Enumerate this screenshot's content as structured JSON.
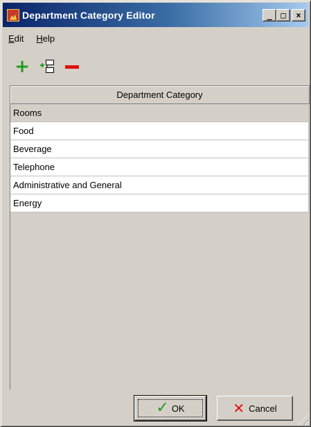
{
  "window": {
    "title": "Department Category Editor",
    "minimize_glyph": "_",
    "maximize_glyph": "□",
    "close_glyph": "×"
  },
  "menu": {
    "edit": {
      "accel": "E",
      "rest": "dit"
    },
    "help": {
      "accel": "H",
      "rest": "elp"
    }
  },
  "toolbar": {
    "add_icon": "plus-icon",
    "add_child_icon": "add-child-icon",
    "remove_icon": "minus-icon"
  },
  "table": {
    "column_header": "Department Category",
    "rows": [
      "Rooms",
      "Food",
      "Beverage",
      "Telephone",
      "Administrative and General",
      "Energy"
    ],
    "selected_index": 0
  },
  "buttons": {
    "ok_label": "OK",
    "cancel_label": "Cancel"
  },
  "colors": {
    "title_start": "#0a246a",
    "title_end": "#a6caf0",
    "add_green": "#1f9a1f",
    "remove_red": "#e01010",
    "face": "#d4d0c8"
  }
}
